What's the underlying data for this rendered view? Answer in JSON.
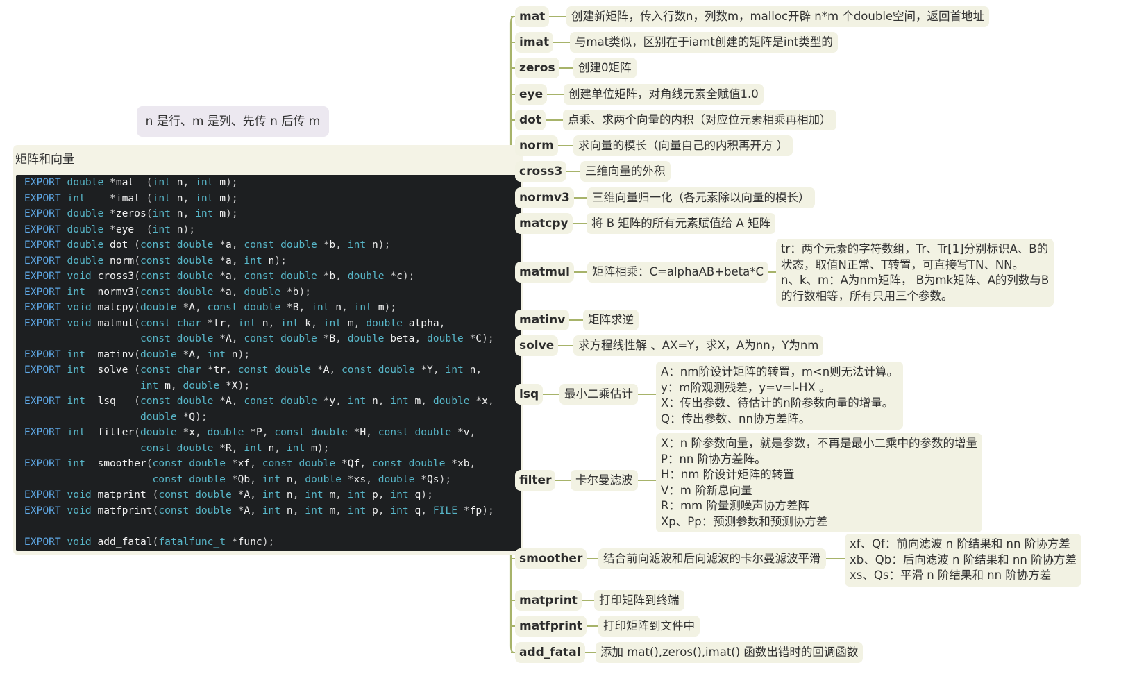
{
  "topic_note": "n 是行、m 是列、先传 n 后传 m",
  "central_title": "矩阵和向量",
  "code_lines": [
    "EXPORT double *mat  (int n, int m);",
    "EXPORT int    *imat (int n, int m);",
    "EXPORT double *zeros(int n, int m);",
    "EXPORT double *eye  (int n);",
    "EXPORT double dot (const double *a, const double *b, int n);",
    "EXPORT double norm(const double *a, int n);",
    "EXPORT void cross3(const double *a, const double *b, double *c);",
    "EXPORT int  normv3(const double *a, double *b);",
    "EXPORT void matcpy(double *A, const double *B, int n, int m);",
    "EXPORT void matmul(const char *tr, int n, int k, int m, double alpha,",
    "                   const double *A, const double *B, double beta, double *C);",
    "EXPORT int  matinv(double *A, int n);",
    "EXPORT int  solve (const char *tr, const double *A, const double *Y, int n,",
    "                   int m, double *X);",
    "EXPORT int  lsq   (const double *A, const double *y, int n, int m, double *x,",
    "                   double *Q);",
    "EXPORT int  filter(double *x, double *P, const double *H, const double *v,",
    "                   const double *R, int n, int m);",
    "EXPORT int  smoother(const double *xf, const double *Qf, const double *xb,",
    "                     const double *Qb, int n, double *xs, double *Qs);",
    "EXPORT void matprint (const double *A, int n, int m, int p, int q);",
    "EXPORT void matfprint(const double *A, int n, int m, int p, int q, FILE *fp);",
    "",
    "EXPORT void add_fatal(fatalfunc_t *func);"
  ],
  "branches": [
    {
      "name": "mat",
      "desc": "创建新矩阵，传入行数n，列数m，malloc开辟 n*m 个double空间，返回首地址"
    },
    {
      "name": "imat",
      "desc": "与mat类似，区别在于iamt创建的矩阵是int类型的"
    },
    {
      "name": "zeros",
      "desc": "创建0矩阵"
    },
    {
      "name": "eye",
      "desc": "创建单位矩阵，对角线元素全赋值1.0"
    },
    {
      "name": "dot",
      "desc": "点乘、求两个向量的内积（对应位元素相乘再相加）"
    },
    {
      "name": "norm",
      "desc": "求向量的模长（向量自己的内积再开方 ）"
    },
    {
      "name": "cross3",
      "desc": "三维向量的外积"
    },
    {
      "name": "normv3",
      "desc": "三维向量归一化（各元素除以向量的模长）"
    },
    {
      "name": "matcpy",
      "desc": "将 B 矩阵的所有元素赋值给 A 矩阵"
    },
    {
      "name": "matmul",
      "desc": "矩阵相乘：C=alphaAB+beta*C",
      "note": [
        "tr：两个元素的字符数组，Tr、Tr[1]分别标识A、B的",
        "状态，取值N正常、T转置，可直接写TN、NN。",
        "n、k、m：A为nm矩阵， B为mk矩阵、A的列数与B",
        "的行数相等，所有只用三个参数。"
      ]
    },
    {
      "name": "matinv",
      "desc": "矩阵求逆"
    },
    {
      "name": "solve",
      "desc": "求方程线性解 、AX=Y，求X，A为nn，Y为nm"
    },
    {
      "name": "lsq",
      "desc": "最小二乘估计",
      "note": [
        "A：nm阶设计矩阵的转置，m<n则无法计算。",
        "y：m阶观测残差，y=v=l-HX 。",
        "X：传出参数、待估计的n阶参数向量的增量。",
        "Q：传出参数、nn协方差阵。"
      ]
    },
    {
      "name": "filter",
      "desc": "卡尔曼滤波",
      "note": [
        "X：n 阶参数向量，就是参数，不再是最小二乘中的参数的增量",
        "P：nn 阶协方差阵。",
        "H：nm 阶设计矩阵的转置",
        "V：m 阶新息向量",
        "R：mm 阶量测噪声协方差阵",
        "Xp、Pp：预测参数和预测协方差"
      ]
    },
    {
      "name": "smoother",
      "desc": "结合前向滤波和后向滤波的卡尔曼滤波平滑",
      "note": [
        "xf、Qf：前向滤波 n 阶结果和 nn 阶协方差",
        "xb、Qb：后向滤波 n 阶结果和 nn 阶协方差",
        "xs、Qs：平滑 n 阶结果和 nn 阶协方差"
      ]
    },
    {
      "name": "matprint",
      "desc": "打印矩阵到终端"
    },
    {
      "name": "matfprint",
      "desc": "打印矩阵到文件中"
    },
    {
      "name": "add_fatal",
      "desc": "添加 mat(),zeros(),imat() 函数出错时的回调函数"
    }
  ],
  "colors": {
    "branch_line": "#a7b36a",
    "node_bg": "#f2f2e3",
    "code_bg": "#1d1f21",
    "keyword": "#5fa8e6",
    "type": "#57b5c7",
    "note_bg": "#ece8f0"
  }
}
